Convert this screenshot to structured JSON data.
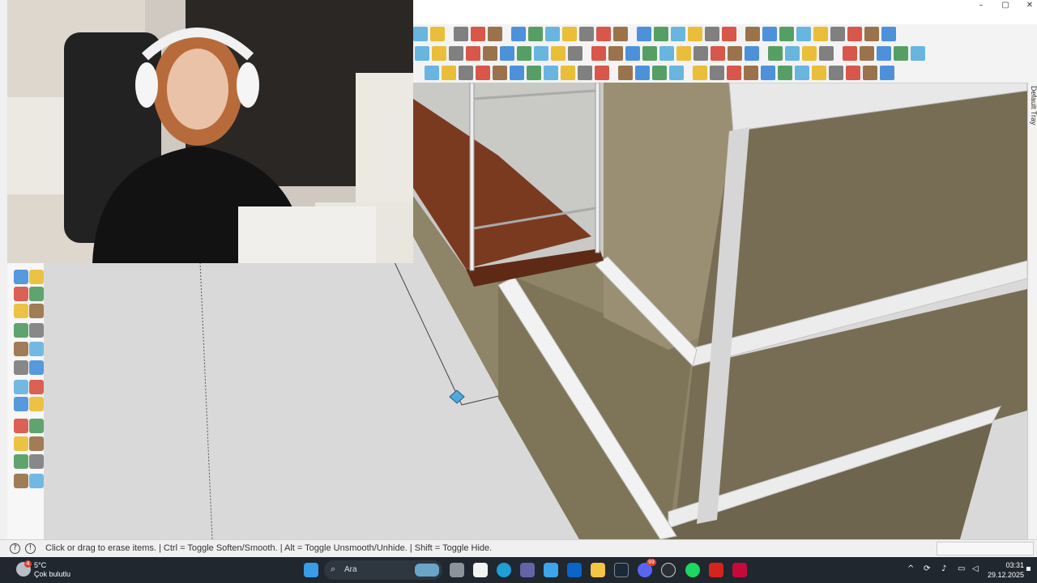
{
  "window": {
    "controls": {
      "minimize": "–",
      "maximize": "▢",
      "close": "✕"
    }
  },
  "tray": {
    "label": "Default Tray"
  },
  "statusbar": {
    "text": "Click or drag to erase items. | Ctrl = Toggle Soften/Smooth. | Alt = Toggle Unsmooth/Unhide. | Shift = Toggle Hide.",
    "help_icon": "question-icon",
    "info_icon": "info-icon"
  },
  "taskbar": {
    "weather": {
      "temperature": "5°C",
      "description": "Çok bulutlu",
      "badge": "4"
    },
    "search": {
      "placeholder": "Ara"
    },
    "apps": [
      "windows-start",
      "search",
      "task-view",
      "microsoft-store",
      "edge",
      "teams",
      "copilot",
      "outlook",
      "file-explorer",
      "steam",
      "discord",
      "github",
      "spotify",
      "sketchup",
      "autocad"
    ],
    "discord_badge": "99",
    "clock": {
      "time": "03:31",
      "date": "29.12.2025"
    }
  },
  "colors": {
    "accent_blue": "#2f7fd6",
    "toolbar_red": "#d33a2c",
    "toolbar_yellow": "#e7b416",
    "wall_olive": "#8a7f66",
    "brick": "#7a3a20",
    "taskbar_bg": "#20272f"
  }
}
